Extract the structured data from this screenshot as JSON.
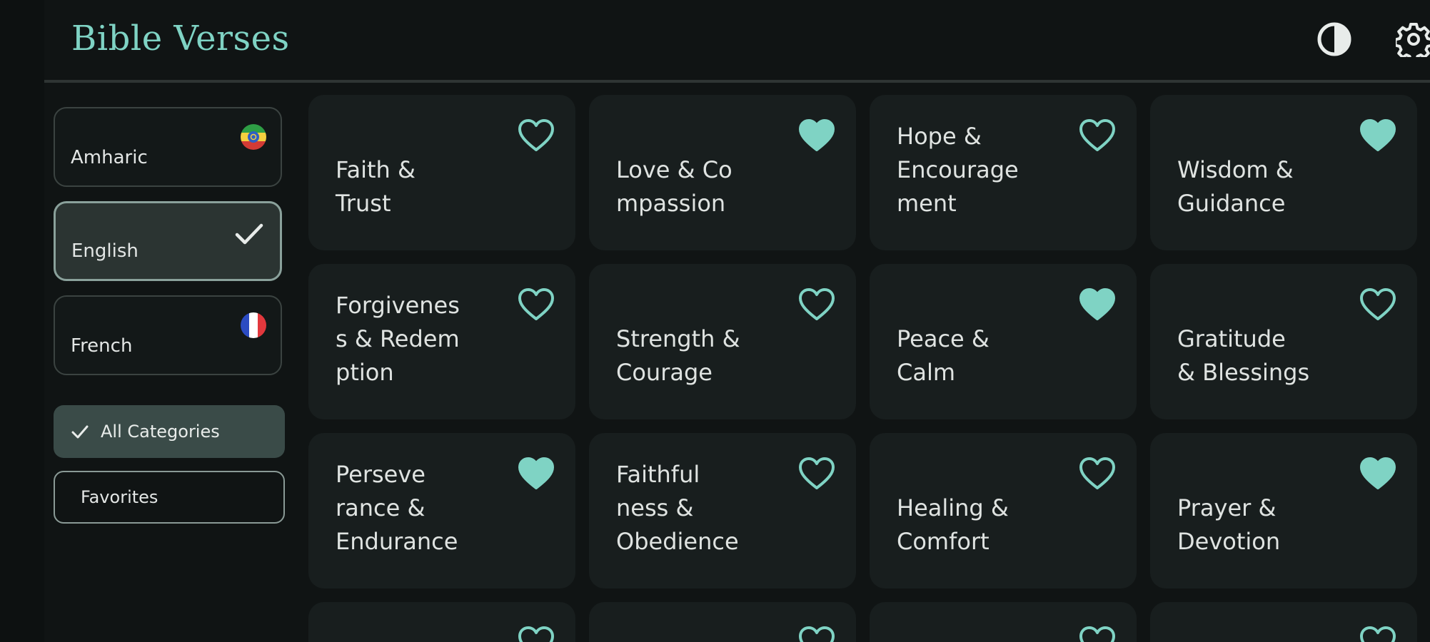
{
  "header": {
    "title": "Bible Verses"
  },
  "colors": {
    "accent": "#7fd3c4",
    "background": "#101414",
    "tile": "#181e1e",
    "selected": "#2b3432"
  },
  "icons": {
    "theme": "contrast-icon",
    "settings": "gear-icon",
    "favorite_filled": "heart-filled-icon",
    "favorite_outline": "heart-outline-icon",
    "check": "check-icon"
  },
  "sidebar": {
    "languages": [
      {
        "label": "Amharic",
        "flag": "ethiopia-flag-icon",
        "selected": false
      },
      {
        "label": "English",
        "selected": true
      },
      {
        "label": "French",
        "flag": "france-flag-icon",
        "selected": false
      }
    ],
    "filters": [
      {
        "label": "All Categories",
        "active": true
      },
      {
        "label": "Favorites",
        "active": false
      }
    ]
  },
  "categories": [
    {
      "label": "Faith &\nTrust",
      "favorite": false
    },
    {
      "label": "Love & Co\nmpassion",
      "favorite": true
    },
    {
      "label": "Hope &\nEncourage\nment",
      "favorite": false
    },
    {
      "label": "Wisdom &\nGuidance",
      "favorite": true
    },
    {
      "label": "Forgivenes\ns & Redem\nption",
      "favorite": false
    },
    {
      "label": "Strength &\nCourage",
      "favorite": false
    },
    {
      "label": "Peace &\nCalm",
      "favorite": true
    },
    {
      "label": "Gratitude\n& Blessings",
      "favorite": false
    },
    {
      "label": "Perseve\nrance &\nEndurance",
      "favorite": true
    },
    {
      "label": "Faithful\nness &\nObedience",
      "favorite": false
    },
    {
      "label": "Healing &\nComfort",
      "favorite": false
    },
    {
      "label": "Prayer &\nDevotion",
      "favorite": true
    }
  ]
}
